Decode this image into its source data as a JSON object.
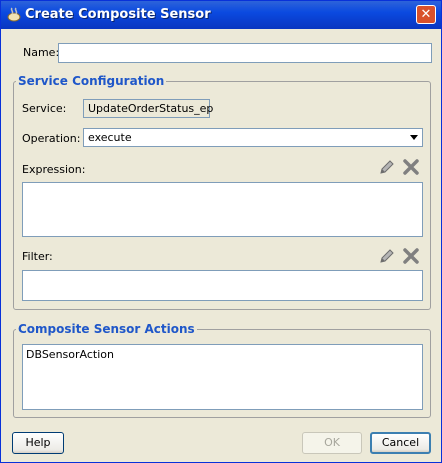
{
  "window": {
    "title": "Create Composite Sensor",
    "close_symbol": "✕"
  },
  "form": {
    "name_label": "Name:",
    "name_value": ""
  },
  "service_config": {
    "legend": "Service Configuration",
    "service_label": "Service:",
    "service_value": "UpdateOrderStatus_ep",
    "operation_label": "Operation:",
    "operation_value": "execute",
    "expression_label": "Expression:",
    "expression_value": "",
    "filter_label": "Filter:",
    "filter_value": ""
  },
  "sensor_actions": {
    "legend": "Composite Sensor Actions",
    "items": [
      "DBSensorAction"
    ]
  },
  "buttons": {
    "help": "Help",
    "ok": "OK",
    "cancel": "Cancel"
  },
  "colors": {
    "legend": "#1f57c9",
    "titlebar": "#0b4ae0",
    "close": "#d9512b"
  },
  "icons": [
    "app-icon",
    "close-icon",
    "edit-pencil-icon",
    "delete-x-icon",
    "dropdown-arrow-icon"
  ]
}
